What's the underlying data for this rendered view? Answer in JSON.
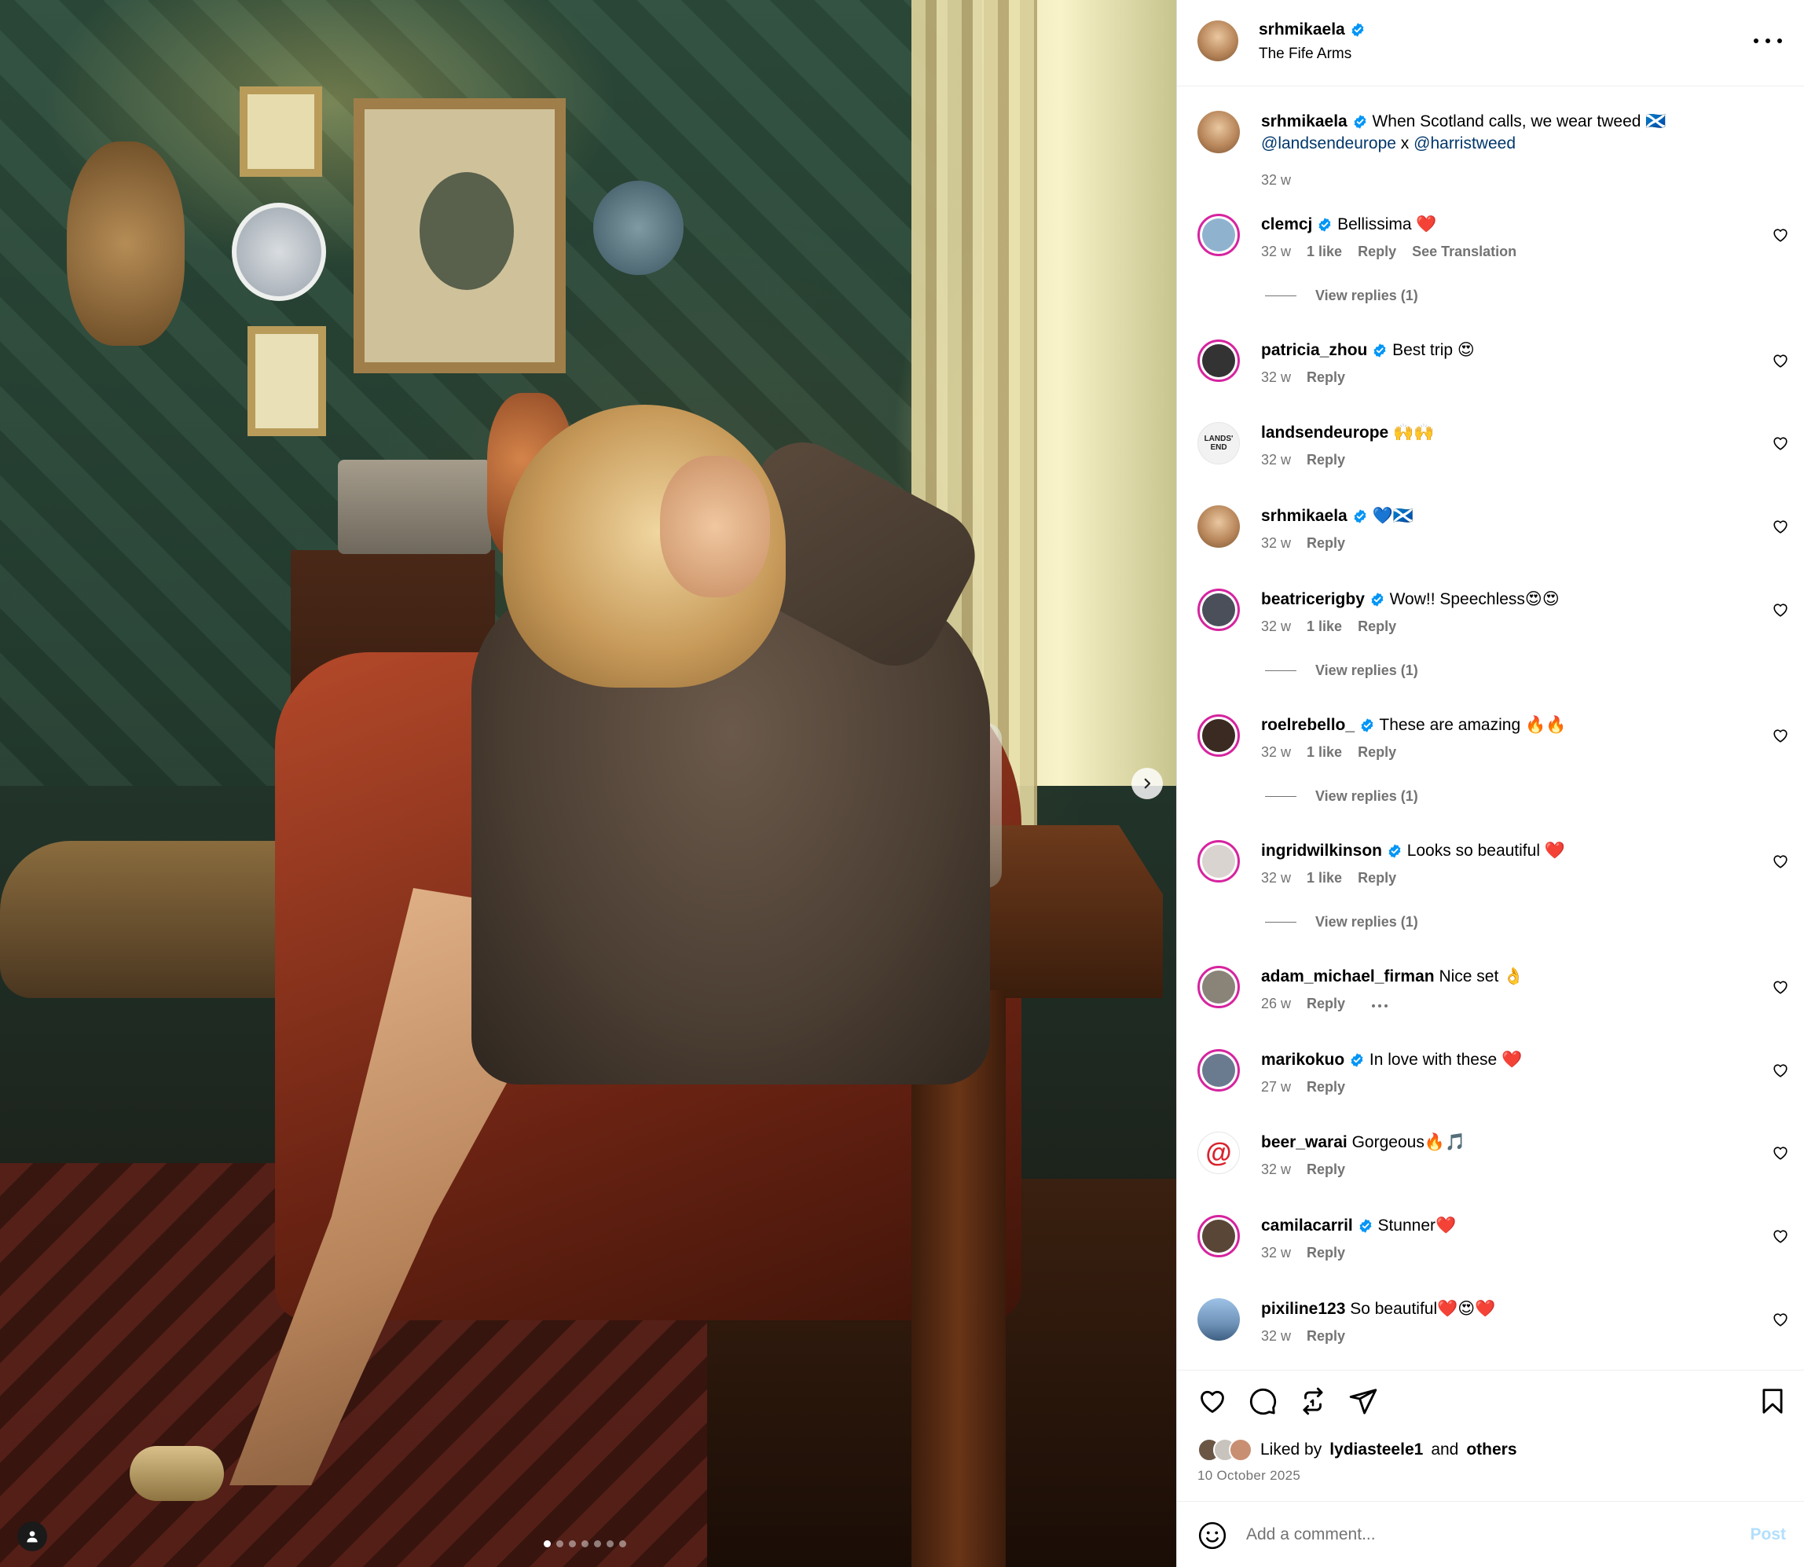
{
  "post": {
    "author": "srhmikaela",
    "location": "The Fife Arms",
    "carousel": {
      "count": 7,
      "active_index": 0
    }
  },
  "caption": {
    "username": "srhmikaela",
    "text": "When Scotland calls, we wear tweed 🏴󠁧󠁢󠁳󠁣󠁴󠁿",
    "mention1": "@landsendeurope",
    "connector": "x",
    "mention2": "@harristweed",
    "time": "32 w"
  },
  "comments": [
    {
      "username": "clemcj",
      "verified": true,
      "text": "Bellissima ❤️",
      "time": "32 w",
      "likes": "1 like",
      "reply": "Reply",
      "extra": "See Translation",
      "view_replies": "View replies (1)",
      "avatar_color": "#8fb3cf"
    },
    {
      "username": "patricia_zhou",
      "verified": true,
      "text": "Best trip 😍",
      "time": "32 w",
      "reply": "Reply",
      "avatar_color": "#333333"
    },
    {
      "username": "landsendeurope",
      "verified": false,
      "text": "🙌🙌",
      "time": "32 w",
      "reply": "Reply",
      "avatar_text": "LANDS' END",
      "avatar_color": "#f2f2f2"
    },
    {
      "username": "srhmikaela",
      "verified": true,
      "text": "💙🏴󠁧󠁢󠁳󠁣󠁴󠁿",
      "time": "32 w",
      "reply": "Reply",
      "avatar_color": "#c59a6c"
    },
    {
      "username": "beatricerigby",
      "verified": true,
      "text": "Wow!! Speechless😍😍",
      "time": "32 w",
      "likes": "1 like",
      "reply": "Reply",
      "view_replies": "View replies (1)",
      "avatar_color": "#4a4f5a"
    },
    {
      "username": "roelrebello_",
      "verified": true,
      "text": "These are amazing 🔥🔥",
      "time": "32 w",
      "likes": "1 like",
      "reply": "Reply",
      "view_replies": "View replies (1)",
      "avatar_color": "#3a2a22"
    },
    {
      "username": "ingridwilkinson",
      "verified": true,
      "text": "Looks so beautiful ❤️",
      "time": "32 w",
      "likes": "1 like",
      "reply": "Reply",
      "view_replies": "View replies (1)",
      "avatar_color": "#d9d4cf"
    },
    {
      "username": "adam_michael_firman",
      "verified": false,
      "text": "Nice set 👌",
      "time": "26 w",
      "reply": "Reply",
      "more": true,
      "avatar_color": "#8a8378"
    },
    {
      "username": "marikokuo",
      "verified": true,
      "text": "In love with these ❤️",
      "time": "27 w",
      "reply": "Reply",
      "avatar_color": "#6a7a8f"
    },
    {
      "username": "beer_warai",
      "verified": false,
      "text": "Gorgeous🔥🎵",
      "time": "32 w",
      "reply": "Reply",
      "avatar_text": "@",
      "avatar_color": "#ffffff"
    },
    {
      "username": "camilacarril",
      "verified": true,
      "text": "Stunner❤️",
      "time": "32 w",
      "reply": "Reply",
      "avatar_color": "#5a4636"
    },
    {
      "username": "pixiline123",
      "verified": false,
      "text": "So beautiful❤️😍❤️",
      "time": "32 w",
      "reply": "Reply",
      "avatar_color": "#6f93b8"
    }
  ],
  "actions": {
    "liked_by_prefix": "Liked by",
    "liked_by_user": "lydiasteele1",
    "liked_by_and": "and",
    "liked_by_others": "others",
    "date": "10 October 2025"
  },
  "add_comment": {
    "placeholder": "Add a comment...",
    "post_label": "Post"
  },
  "icons": {
    "verified": "verified-badge-icon",
    "heart": "heart-icon",
    "comment": "comment-icon",
    "repost": "repost-icon",
    "share": "share-icon",
    "bookmark": "bookmark-icon",
    "emoji": "emoji-icon",
    "more": "more-icon",
    "next": "chevron-right-icon",
    "tag": "user-tag-icon"
  },
  "colors": {
    "verified": "#0095f6",
    "link": "#00376b",
    "muted": "#737373",
    "post_disabled": "#b2dffc",
    "story_ring": "#d6249f"
  }
}
